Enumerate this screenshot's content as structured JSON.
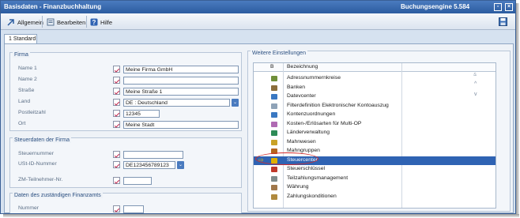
{
  "window": {
    "title": "Basisdaten - Finanzbuchhaltung",
    "engine": "Buchungsengine 5.584"
  },
  "toolbar": {
    "allgemein": "Allgemein",
    "bearbeiten": "Bearbeiten",
    "hilfe": "Hilfe"
  },
  "tab": {
    "label": "1 Standard"
  },
  "firma": {
    "title": "Firma",
    "labels": {
      "name1": "Name 1",
      "name2": "Name 2",
      "strasse": "Straße",
      "land": "Land",
      "plz": "Postleitzahl",
      "ort": "Ort"
    },
    "values": {
      "name1": "Meine Firma GmbH",
      "name2": "",
      "strasse": "Meine Straße 1",
      "land": "DE   : Deutschland",
      "plz": "12345",
      "ort": "Meine Stadt"
    }
  },
  "steuer": {
    "title": "Steuerdaten der Firma",
    "labels": {
      "steuernummer": "Steuernummer",
      "ustid": "USt-ID-Nummer",
      "zm": "ZM-Teilnehmer-Nr."
    },
    "values": {
      "steuernummer": "",
      "ustid": "DE123456789123",
      "zm": ""
    }
  },
  "finanzamt": {
    "title": "Daten des zuständigen Finanzamts",
    "labels": {
      "nummer": "Nummer"
    },
    "values": {
      "nummer": ""
    }
  },
  "weitere": {
    "title": "Weitere Einstellungen",
    "col_b": "B",
    "col_bezeichnung": "Bezeichnung",
    "items": [
      {
        "label": "Adressnummernkreise",
        "color": "#6f8f3a"
      },
      {
        "label": "Banken",
        "color": "#8a6d3b"
      },
      {
        "label": "Datevcenter",
        "color": "#3a78c2"
      },
      {
        "label": "Filterdefinition Elektronischer Kontoauszug",
        "color": "#8fa3b8"
      },
      {
        "label": "Kontenzuordnungen",
        "color": "#3a78c2"
      },
      {
        "label": "Kosten-/Erlösarten für Multi-OP",
        "color": "#b06ab3"
      },
      {
        "label": "Länderverwaltung",
        "color": "#2e8b57"
      },
      {
        "label": "Mahnwesen",
        "color": "#c9a227"
      },
      {
        "label": "Mahngruppen",
        "color": "#b5651d"
      },
      {
        "label": "Steuercenter",
        "color": "#e0b000"
      },
      {
        "label": "Steuerschlüssel",
        "color": "#c0392b"
      },
      {
        "label": "Teilzahlungsmanagement",
        "color": "#7f8c8d"
      },
      {
        "label": "Währung",
        "color": "#a0784b"
      },
      {
        "label": "Zahlungskonditionen",
        "color": "#b08a3e"
      }
    ],
    "selected_index": 9
  }
}
